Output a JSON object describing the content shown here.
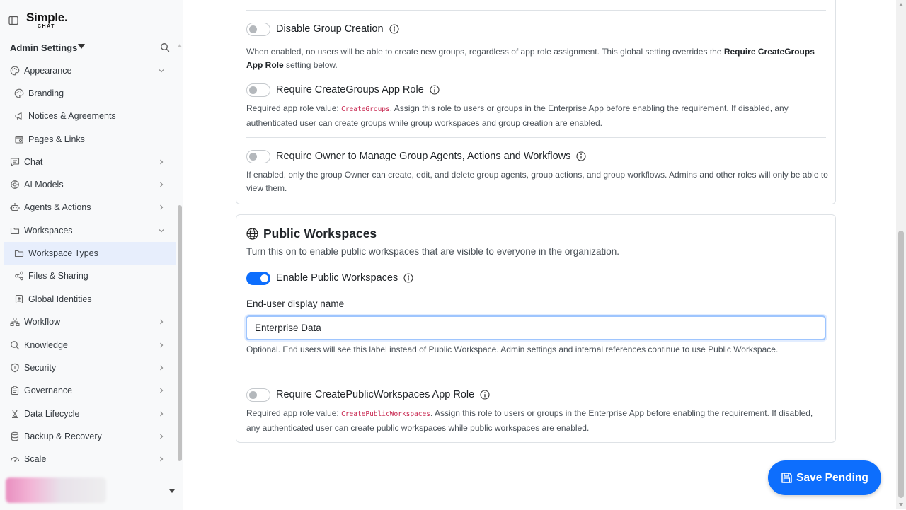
{
  "app": {
    "logo_line1": "Simple.",
    "logo_line2": "CHAT"
  },
  "sidebar": {
    "section_title": "Admin Settings",
    "items": [
      {
        "label": "Appearance",
        "icon": "palette-icon",
        "chevron": "down"
      },
      {
        "label": "Branding",
        "icon": "palette-icon"
      },
      {
        "label": "Notices & Agreements",
        "icon": "megaphone-icon"
      },
      {
        "label": "Pages & Links",
        "icon": "pages-icon"
      },
      {
        "label": "Chat",
        "icon": "chat-icon",
        "chevron": "right"
      },
      {
        "label": "AI Models",
        "icon": "cpu-icon",
        "chevron": "right"
      },
      {
        "label": "Agents & Actions",
        "icon": "robot-icon",
        "chevron": "right"
      },
      {
        "label": "Workspaces",
        "icon": "folder-icon",
        "chevron": "down"
      },
      {
        "label": "Workspace Types",
        "icon": "folder-icon",
        "active": true
      },
      {
        "label": "Files & Sharing",
        "icon": "share-icon"
      },
      {
        "label": "Global Identities",
        "icon": "badge-icon"
      },
      {
        "label": "Workflow",
        "icon": "workflow-icon",
        "chevron": "right"
      },
      {
        "label": "Knowledge",
        "icon": "search-icon",
        "chevron": "right"
      },
      {
        "label": "Security",
        "icon": "shield-icon",
        "chevron": "right"
      },
      {
        "label": "Governance",
        "icon": "clipboard-icon",
        "chevron": "right"
      },
      {
        "label": "Data Lifecycle",
        "icon": "hourglass-icon",
        "chevron": "right"
      },
      {
        "label": "Backup & Recovery",
        "icon": "database-icon",
        "chevron": "right"
      },
      {
        "label": "Scale",
        "icon": "gauge-icon",
        "chevron": "right"
      }
    ]
  },
  "groups": {
    "disable_creation": {
      "label": "Disable Group Creation",
      "enabled": false,
      "help_pre": "When enabled, no users will be able to create new groups, regardless of app role assignment. This global setting overrides the ",
      "help_bold": "Require CreateGroups App Role",
      "help_post": " setting below."
    },
    "require_role": {
      "label": "Require CreateGroups App Role",
      "enabled": false,
      "help_pre": "Required app role value: ",
      "help_code": "CreateGroups",
      "help_post": ". Assign this role to users or groups in the Enterprise App before enabling the requirement. If disabled, any authenticated user can create groups while group workspaces and group creation are enabled."
    },
    "require_owner": {
      "label": "Require Owner to Manage Group Agents, Actions and Workflows",
      "enabled": false,
      "help": "If enabled, only the group Owner can create, edit, and delete group agents, group actions, and group workflows. Admins and other roles will only be able to view them."
    }
  },
  "public_workspaces": {
    "title": "Public Workspaces",
    "description": "Turn this on to enable public workspaces that are visible to everyone in the organization.",
    "enable": {
      "label": "Enable Public Workspaces",
      "enabled": true
    },
    "display_name": {
      "label": "End-user display name",
      "value": "Enterprise Data",
      "help": "Optional. End users will see this label instead of Public Workspace. Admin settings and internal references continue to use Public Workspace."
    },
    "require_role": {
      "label": "Require CreatePublicWorkspaces App Role",
      "enabled": false,
      "help_pre": "Required app role value: ",
      "help_code": "CreatePublicWorkspaces",
      "help_post": ". Assign this role to users or groups in the Enterprise App before enabling the requirement. If disabled, any authenticated user can create public workspaces while public workspaces are enabled."
    }
  },
  "save_button": {
    "label": "Save Pending"
  },
  "colors": {
    "accent": "#0d6efd",
    "active_nav": "#e7eefc",
    "code": "#c7254e"
  }
}
